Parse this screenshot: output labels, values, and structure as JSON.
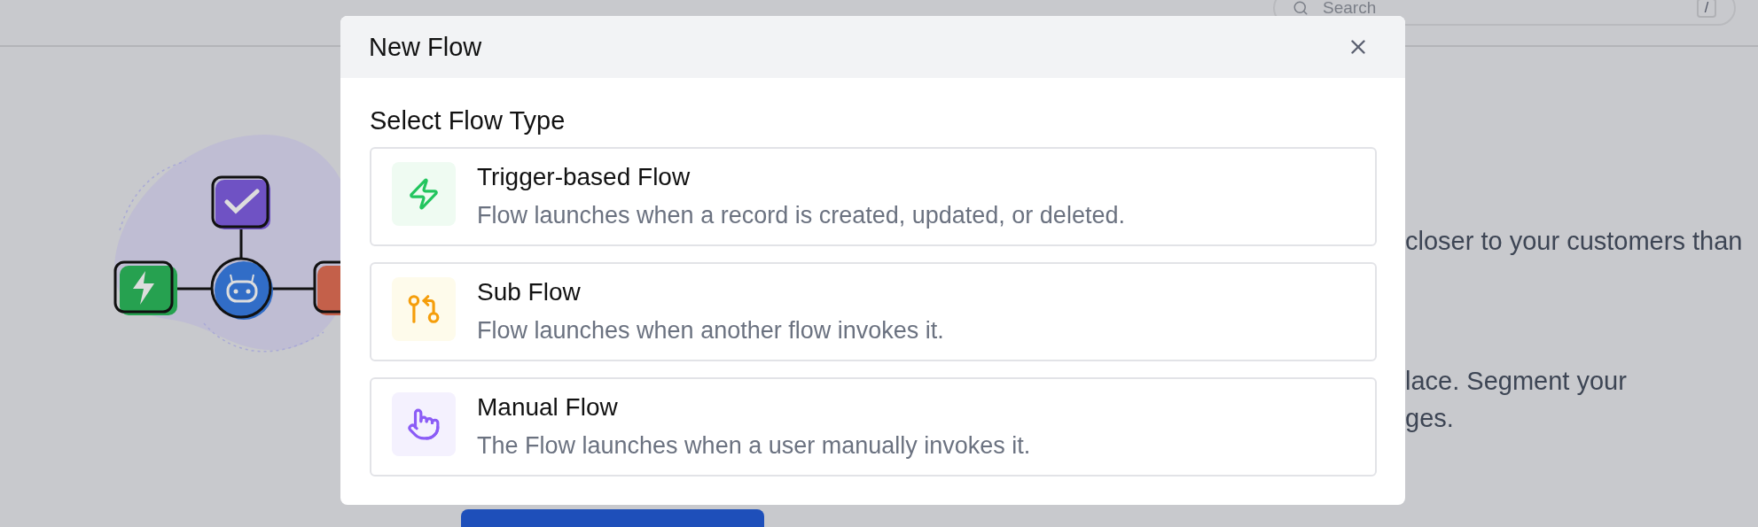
{
  "header": {
    "search": {
      "placeholder": "Search",
      "shortcut": "/"
    }
  },
  "background_paragraphs": [
    {
      "lines": [
        "closer to your customers than"
      ]
    },
    {
      "lines": [
        "lace. Segment your",
        "ges."
      ]
    }
  ],
  "modal": {
    "title": "New Flow",
    "section_label": "Select Flow Type",
    "options": [
      {
        "kind": "trigger",
        "title": "Trigger-based Flow",
        "description": "Flow launches when a record is created, updated, or deleted."
      },
      {
        "kind": "sub",
        "title": "Sub Flow",
        "description": "Flow launches when another flow invokes it."
      },
      {
        "kind": "manual",
        "title": "Manual Flow",
        "description": "The Flow launches when a user manually invokes it."
      }
    ]
  }
}
